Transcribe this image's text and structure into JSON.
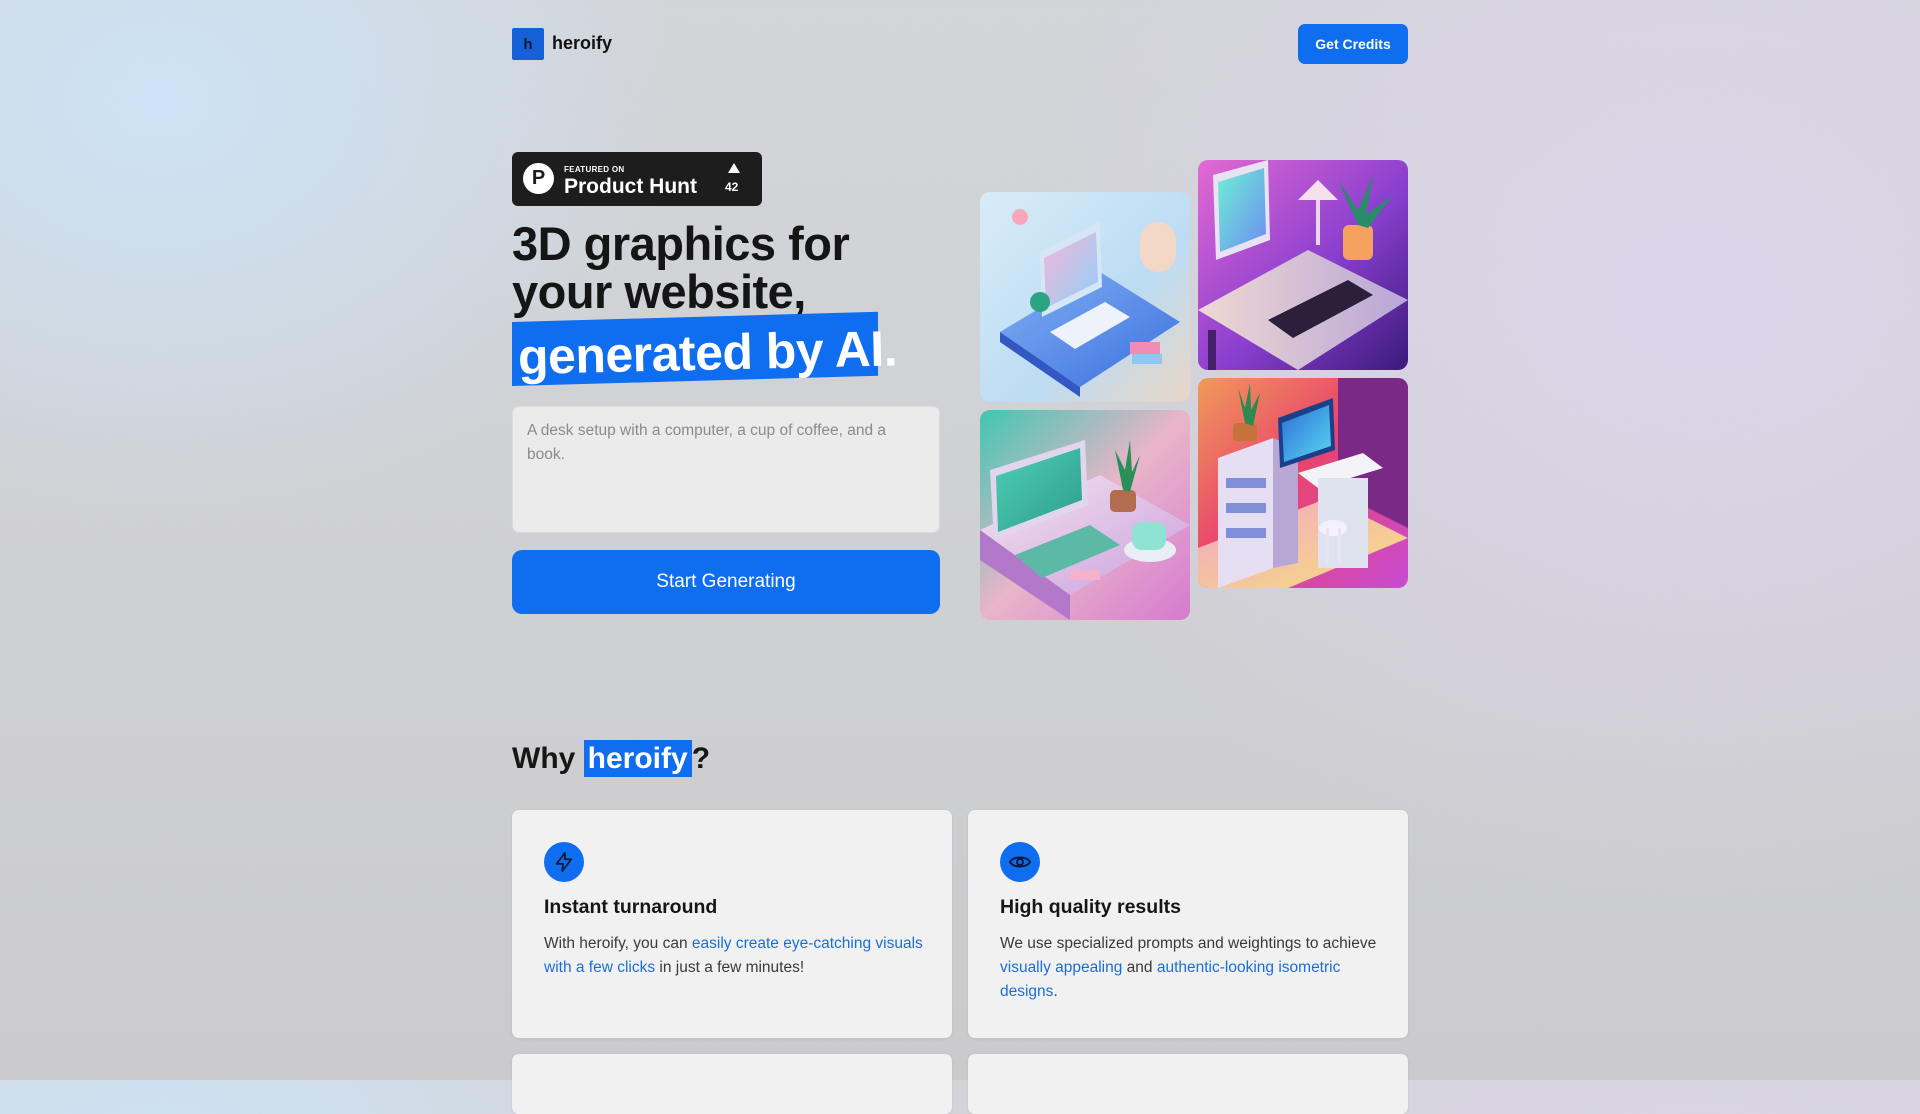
{
  "header": {
    "logo_letter": "h",
    "logo_text": "heroify",
    "credits_button": "Get Credits"
  },
  "product_hunt": {
    "featured": "FEATURED ON",
    "name": "Product Hunt",
    "letter": "P",
    "upvotes": "42"
  },
  "hero": {
    "line1": "3D graphics for",
    "line2": "your website,",
    "highlight": "generated by AI.",
    "prompt_placeholder": "A desk setup with a computer, a cup of coffee, and a book.",
    "generate_button": "Start Generating"
  },
  "why": {
    "prefix": "Why ",
    "brand": "heroify",
    "suffix": "?"
  },
  "features": [
    {
      "icon": "lightning-icon",
      "title": "Instant turnaround",
      "desc_before": "With heroify, you can ",
      "desc_link": "easily create eye-catching visuals with a few clicks",
      "desc_after": " in just a few minutes!"
    },
    {
      "icon": "eye-icon",
      "title": "High quality results",
      "desc_before": "We use specialized prompts and weightings to achieve ",
      "desc_link": "visually appealing",
      "desc_middle": " and ",
      "desc_link2": "authentic-looking isometric designs",
      "desc_after": "."
    }
  ],
  "colors": {
    "accent": "#0f6df0",
    "logo": "#1560d6",
    "link": "#1a6fd6"
  }
}
